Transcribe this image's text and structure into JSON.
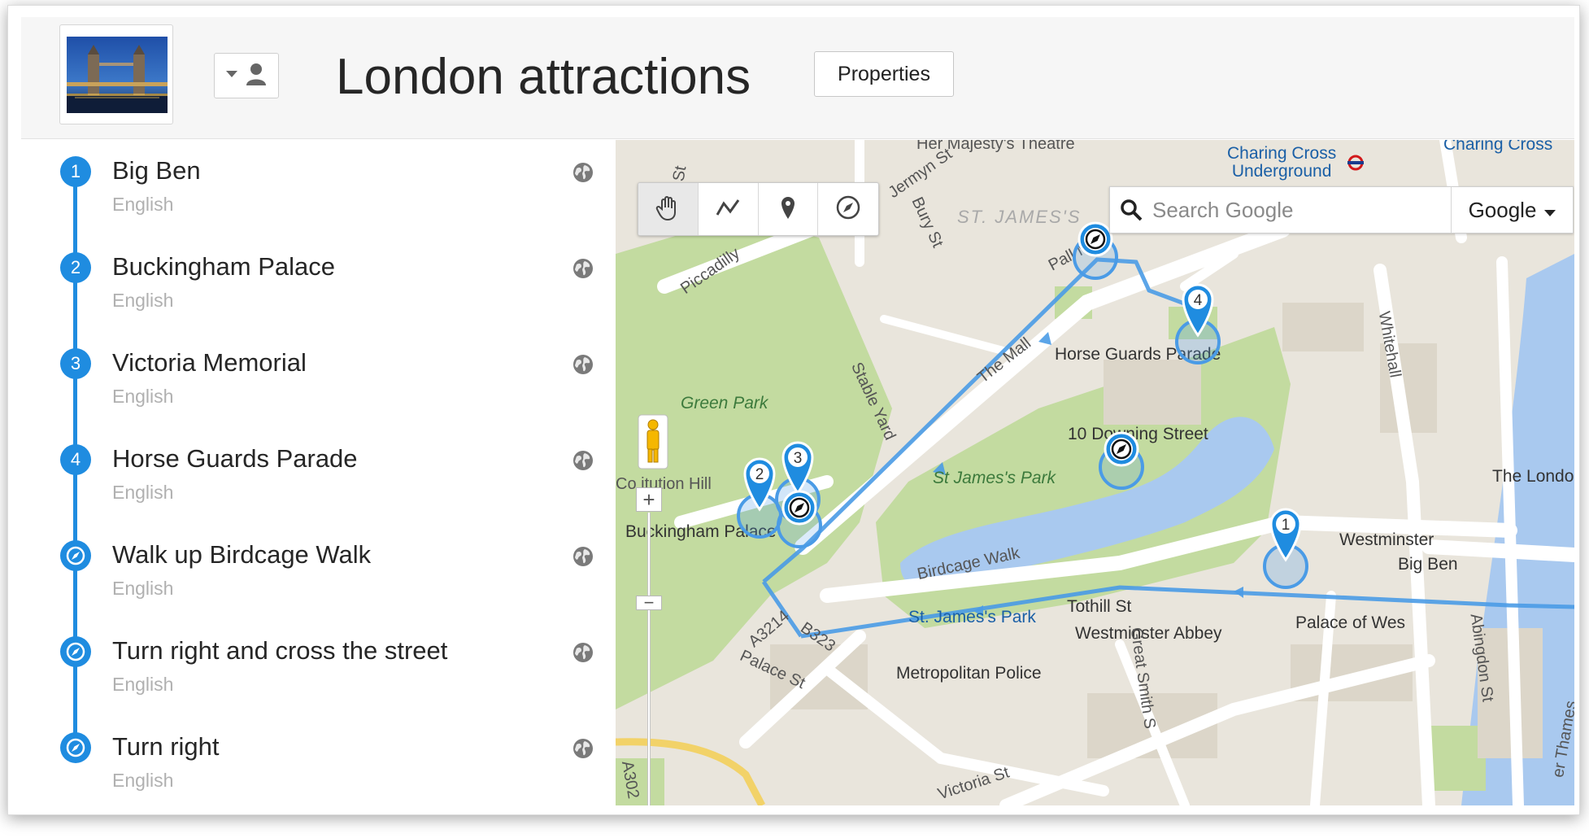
{
  "header": {
    "title": "London attractions",
    "properties_label": "Properties",
    "thumbnail_icon": "tower-bridge-image",
    "owner_icon": "person-icon"
  },
  "tour": {
    "items": [
      {
        "badge": "1",
        "kind": "place",
        "title": "Big Ben",
        "language": "English"
      },
      {
        "badge": "2",
        "kind": "place",
        "title": "Buckingham Palace",
        "language": "English"
      },
      {
        "badge": "3",
        "kind": "place",
        "title": "Victoria Memorial",
        "language": "English"
      },
      {
        "badge": "4",
        "kind": "place",
        "title": "Horse Guards Parade",
        "language": "English"
      },
      {
        "badge": "",
        "kind": "direction",
        "title": "Walk up Birdcage Walk",
        "language": "English"
      },
      {
        "badge": "",
        "kind": "direction",
        "title": "Turn right and cross the street",
        "language": "English"
      },
      {
        "badge": "",
        "kind": "direction",
        "title": "Turn right",
        "language": "English"
      }
    ]
  },
  "map": {
    "search_placeholder": "Search Google",
    "provider": "Google",
    "zoom_in": "+",
    "zoom_out": "−",
    "tool_icons": [
      "hand-icon",
      "line-icon",
      "pin-icon",
      "compass-icon"
    ],
    "accent_color": "#1f8ce0",
    "labels": {
      "top_theatre": "Her Majesty's Theatre",
      "charing_cross_underground": "Charing Cross\nUnderground",
      "charing_cross": "Charing Cross",
      "st_sign": "St",
      "jermyn": "Jermyn St",
      "bury": "Bury St",
      "st_jamess": "ST. JAMES'S",
      "pall_mall": "Pall Mal",
      "piccadilly": "Piccadilly",
      "horse_guards": "Horse Guards Parade",
      "whitehall": "Whitehall",
      "green_park": "Green Park",
      "the_mall": "The Mall",
      "stable_yard": "Stable Yard",
      "downing": "10 Downing Street",
      "st_james_park": "St James's Park",
      "constitution_hill": "Co   itution Hill",
      "the_london": "The Londo",
      "buckingham_palace": "Buckingham Palace",
      "westminster": "Westminster",
      "big_ben": "Big Ben",
      "birdcage_walk": "Birdcage Walk",
      "a3214": "A3214",
      "b323": "B323",
      "st_jamess_park_station": "St. James's Park",
      "tothill": "Tothill St",
      "westminster_abbey": "Westminster Abbey",
      "abingdon": "Abingdon St",
      "palace_westminster": "Palace of Wes",
      "palace_st": "Palace St",
      "great_smith": "Great Smith S",
      "met_police": "Metropolitan Police",
      "victoria_st": "Victoria St",
      "river_thames": "er Thames",
      "a302": "A302"
    },
    "markers": [
      {
        "label": "1",
        "kind": "place"
      },
      {
        "label": "2",
        "kind": "place"
      },
      {
        "label": "3",
        "kind": "place"
      },
      {
        "label": "4",
        "kind": "place"
      },
      {
        "label": "",
        "kind": "direction"
      },
      {
        "label": "",
        "kind": "direction"
      },
      {
        "label": "",
        "kind": "direction"
      }
    ]
  }
}
